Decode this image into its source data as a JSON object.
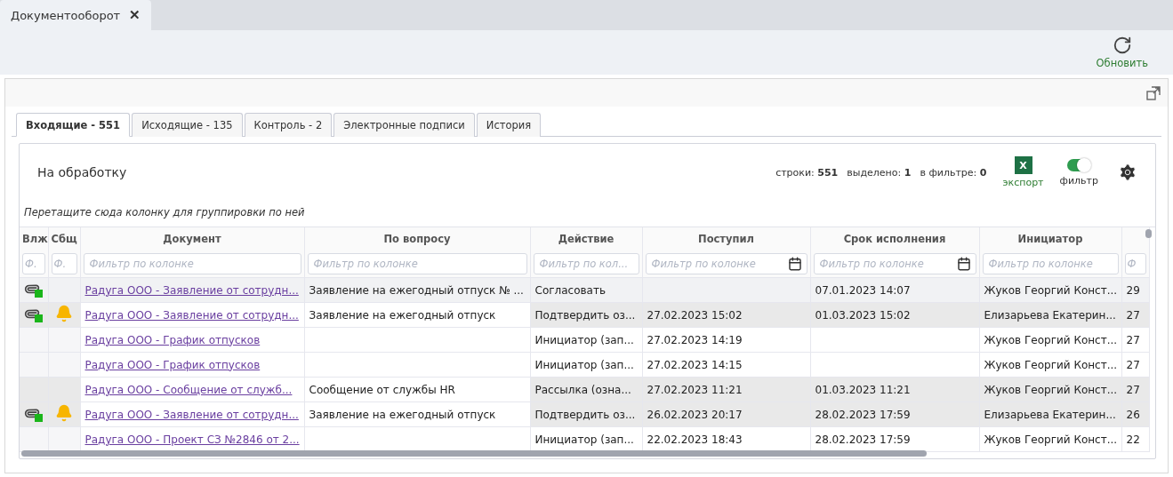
{
  "app_tabs": [
    {
      "label": "Документооборот",
      "selected": true,
      "close": "✕"
    }
  ],
  "toolbar": {
    "refresh": "Обновить"
  },
  "tabs": [
    {
      "label": "Входящие - 551",
      "selected": true
    },
    {
      "label": "Исходящие - 135",
      "selected": false
    },
    {
      "label": "Контроль - 2",
      "selected": false
    },
    {
      "label": "Электронные подписи",
      "selected": false
    },
    {
      "label": "История",
      "selected": false
    }
  ],
  "card": {
    "title": "На обработку",
    "stats": [
      "строки: **551**",
      "выделено: **1**",
      "в фильтре: **0**"
    ],
    "export_letter": "X",
    "export": "экспорт",
    "filter": "фильтр",
    "filter_on": true,
    "group_hint": "Перетащите сюда колонку для группировки по ней"
  },
  "table": {
    "columns": [
      {
        "label": "Влж",
        "placeholder": "Ф.",
        "kind": "attachment"
      },
      {
        "label": "Сбщ",
        "placeholder": "Ф.",
        "kind": "bell"
      },
      {
        "label": "Документ",
        "placeholder": "Фильтр по колонке",
        "kind": "link"
      },
      {
        "label": "По вопросу",
        "placeholder": "Фильтр по колонке",
        "kind": "text"
      },
      {
        "label": "Действие",
        "placeholder": "Фильтр по кол...",
        "kind": "text"
      },
      {
        "label": "Поступил",
        "placeholder": "Фильтр по колонке",
        "kind": "date"
      },
      {
        "label": "Срок исполнения",
        "placeholder": "Фильтр по колонке",
        "kind": "date"
      },
      {
        "label": "Инициатор",
        "placeholder": "Фильтр по колонке",
        "kind": "text"
      },
      {
        "placeholder": "Ф",
        "kind": "text"
      }
    ],
    "rows": [
      {
        "attachment": true,
        "bell": false,
        "cells": [
          "",
          "",
          "Радуга ООО - Заявление от сотрудн...",
          "Заявление на ежегодный отпуск № ...",
          "Согласовать",
          "",
          "07.01.2023 14:07",
          "Жуков Георгий Конст...",
          "29"
        ],
        "selected": true,
        "highlighted": false
      },
      {
        "attachment": true,
        "bell": true,
        "cells": [
          "",
          "",
          "Радуга ООО - Заявление от сотрудн...",
          "Заявление на ежегодный отпуск",
          "Подтвердить оз...",
          "27.02.2023 15:02",
          "01.03.2023 15:02",
          "Елизарьева Екатерин...",
          "27"
        ],
        "selected": false,
        "highlighted": true
      },
      {
        "attachment": false,
        "bell": false,
        "cells": [
          "",
          "",
          "Радуга ООО - График отпусков",
          "",
          "Инициатор (зап...",
          "27.02.2023 14:19",
          "",
          "Жуков Георгий Конст...",
          "27"
        ],
        "selected": false,
        "highlighted": false
      },
      {
        "attachment": false,
        "bell": false,
        "cells": [
          "",
          "",
          "Радуга ООО - График отпусков",
          "",
          "Инициатор (зап...",
          "27.02.2023 14:15",
          "",
          "Жуков Георгий Конст...",
          "27"
        ],
        "selected": false,
        "highlighted": false
      },
      {
        "attachment": false,
        "bell": false,
        "cells": [
          "",
          "",
          "Радуга ООО - Сообщение от служб...",
          "Сообщение от службы HR",
          "Рассылка (озна...",
          "27.02.2023 11:21",
          "01.03.2023 11:21",
          "Жуков Георгий Конст...",
          "27"
        ],
        "selected": false,
        "highlighted": true
      },
      {
        "attachment": true,
        "bell": true,
        "cells": [
          "",
          "",
          "Радуга ООО - Заявление от сотрудн...",
          "Заявление на ежегодный отпуск",
          "Подтвердить оз...",
          "26.02.2023 20:17",
          "28.02.2023 17:59",
          "Елизарьева Екатерин...",
          "26"
        ],
        "selected": false,
        "highlighted": true
      },
      {
        "attachment": false,
        "bell": false,
        "cells": [
          "",
          "",
          "Радуга ООО - Проект СЗ №2846 от 2...",
          "",
          "Инициатор (зап...",
          "22.02.2023 18:43",
          "28.02.2023 17:59",
          "Жуков Георгий Конст...",
          "22"
        ],
        "selected": false,
        "highlighted": false
      }
    ]
  }
}
